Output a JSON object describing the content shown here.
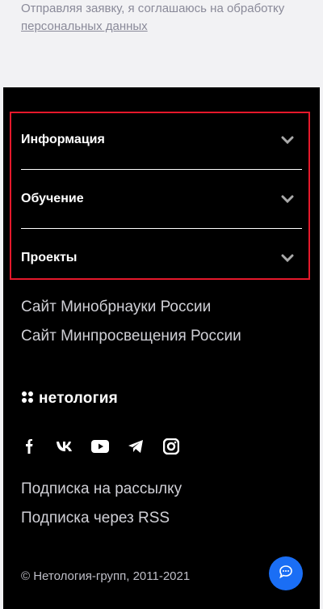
{
  "consent": {
    "text": "Отправляя заявку, я соглашаюсь на обработку",
    "link_label": "персональных данных"
  },
  "accordion": {
    "items": [
      {
        "label": "Информация",
        "icon": "chevron-down-icon"
      },
      {
        "label": "Обучение",
        "icon": "chevron-down-icon"
      },
      {
        "label": "Проекты",
        "icon": "chevron-down-icon"
      }
    ]
  },
  "external_links": [
    {
      "label": "Сайт Минобрнауки России"
    },
    {
      "label": "Сайт Минпросвещения России"
    }
  ],
  "brand": {
    "name": "нетология",
    "icon": "netology-logo-icon"
  },
  "social": [
    {
      "name": "facebook-icon"
    },
    {
      "name": "vk-icon"
    },
    {
      "name": "youtube-icon"
    },
    {
      "name": "telegram-icon"
    },
    {
      "name": "instagram-icon"
    }
  ],
  "subscriptions": [
    {
      "label": "Подписка на рассылку"
    },
    {
      "label": "Подписка через RSS"
    }
  ],
  "copyright": "© Нетология-групп, 2011-2021",
  "chat": {
    "icon": "chat-icon"
  },
  "colors": {
    "footer_bg": "#000000",
    "page_bg": "#f2f2f4",
    "highlight_border": "#e5182b",
    "chat_button": "#1a6ef5"
  }
}
